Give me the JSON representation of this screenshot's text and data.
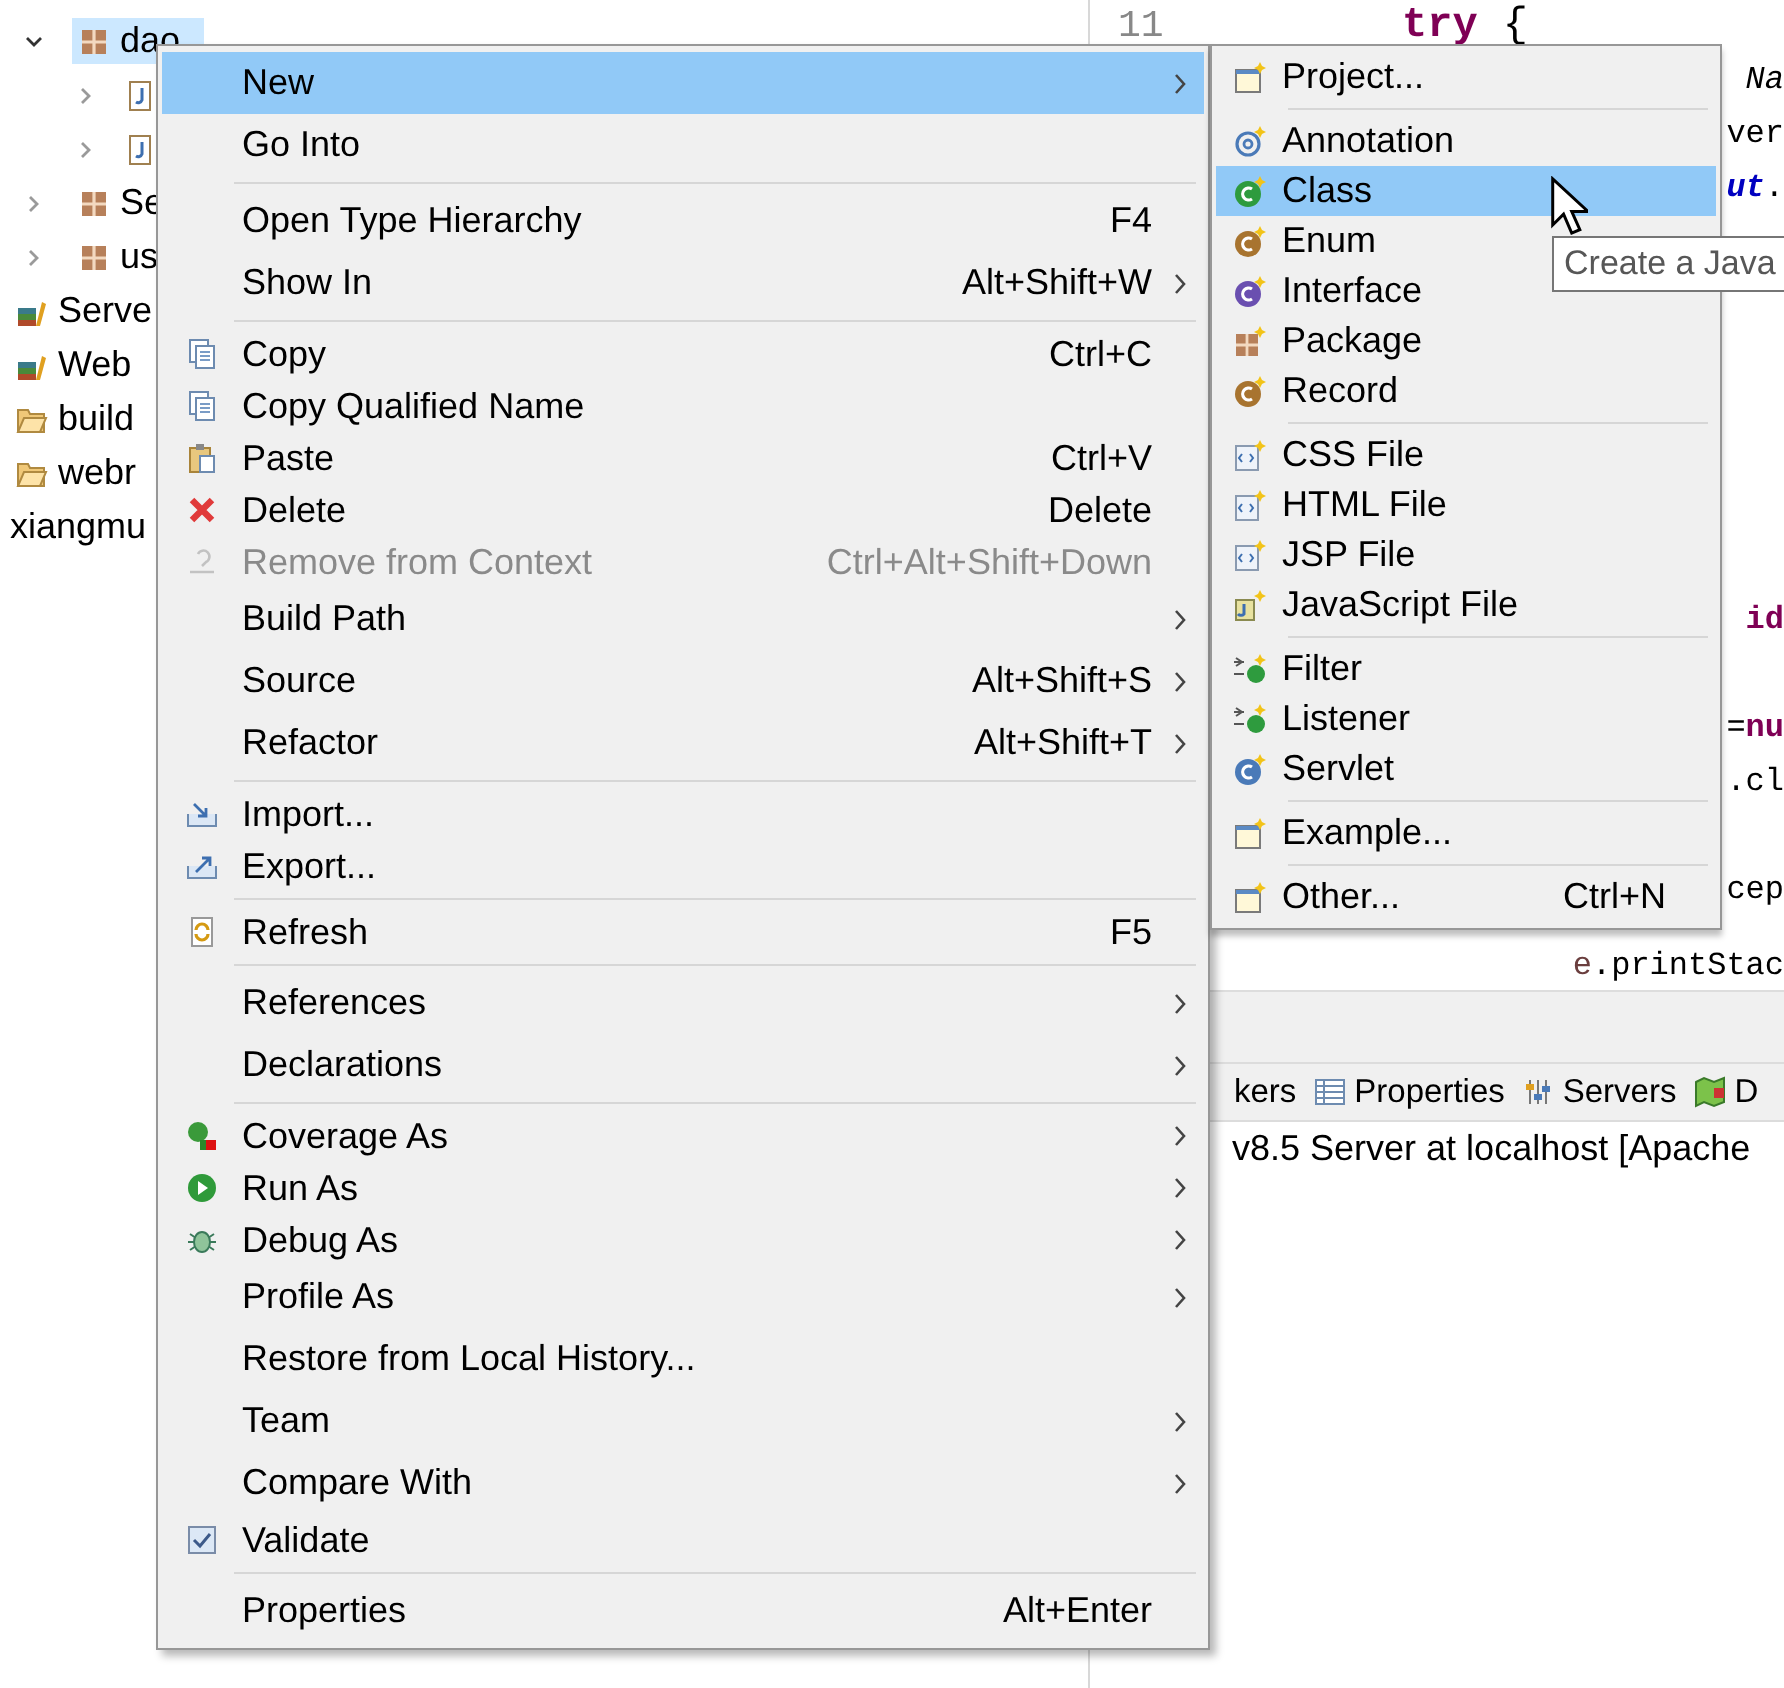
{
  "project_explorer": {
    "items": [
      {
        "kind": "package",
        "label": "dao",
        "expanded": true,
        "selected": true,
        "children": [
          {
            "kind": "java_file",
            "expanded": false
          },
          {
            "kind": "java_file",
            "expanded": false
          }
        ]
      },
      {
        "kind": "package",
        "label": "Se",
        "expanded": false,
        "selected": false
      },
      {
        "kind": "package",
        "label": "us",
        "expanded": false,
        "selected": false
      },
      {
        "kind": "library",
        "label": "Serve",
        "selected": false
      },
      {
        "kind": "library",
        "label": "Web",
        "selected": false
      },
      {
        "kind": "folder",
        "label": "build",
        "selected": false
      },
      {
        "kind": "folder",
        "label": "webr",
        "selected": false
      },
      {
        "kind": "project",
        "label": "xiangmu",
        "selected": false
      }
    ]
  },
  "editor": {
    "line_number": "11",
    "lines": [
      {
        "kind": "line",
        "segments": [
          {
            "text": "try",
            "kind": "keyword"
          },
          {
            "text": " {",
            "kind": "plain"
          }
        ]
      },
      {
        "kind": "fragment",
        "segments": [
          {
            "text": "Na",
            "kind": "italic"
          }
        ]
      },
      {
        "kind": "fragment",
        "segments": [
          {
            "text": "ver",
            "kind": "plain"
          }
        ]
      },
      {
        "kind": "fragment",
        "segments": [
          {
            "text": "ut",
            "kind": "static"
          },
          {
            "text": ".",
            "kind": "plain"
          }
        ]
      },
      {
        "kind": "fragment",
        "segments": [
          {
            "text": "id",
            "kind": "keyword"
          }
        ]
      },
      {
        "kind": "fragment",
        "segments": [
          {
            "text": "=",
            "kind": "plain"
          },
          {
            "text": "nu",
            "kind": "keyword"
          }
        ]
      },
      {
        "kind": "fragment",
        "segments": [
          {
            "text": ".cl",
            "kind": "plain"
          }
        ]
      },
      {
        "kind": "fragment",
        "segments": [
          {
            "text": "cep",
            "kind": "plain"
          }
        ]
      },
      {
        "kind": "fragment",
        "segments": [
          {
            "text": "e",
            "kind": "local"
          },
          {
            "text": ".printStac",
            "kind": "plain"
          }
        ]
      }
    ]
  },
  "bottom_panel": {
    "tabs": [
      {
        "label": "kers"
      },
      {
        "label": "Properties"
      },
      {
        "label": "Servers"
      },
      {
        "label": "D"
      }
    ],
    "console_line": "v8.5 Server at localhost [Apache"
  },
  "context_menu": {
    "items": [
      {
        "kind": "item",
        "label": "New",
        "submenu": true,
        "selected": true
      },
      {
        "kind": "item",
        "label": "Go Into",
        "selected": false
      },
      {
        "kind": "separator"
      },
      {
        "kind": "item",
        "label": "Open Type Hierarchy",
        "shortcut": "F4",
        "selected": false
      },
      {
        "kind": "item",
        "label": "Show In",
        "shortcut": "Alt+Shift+W",
        "submenu": true,
        "selected": false
      },
      {
        "kind": "separator"
      },
      {
        "kind": "item",
        "label": "Copy",
        "shortcut": "Ctrl+C",
        "selected": false
      },
      {
        "kind": "item",
        "label": "Copy Qualified Name",
        "selected": false
      },
      {
        "kind": "item",
        "label": "Paste",
        "shortcut": "Ctrl+V",
        "selected": false
      },
      {
        "kind": "item",
        "label": "Delete",
        "shortcut": "Delete",
        "selected": false
      },
      {
        "kind": "item",
        "label": "Remove from Context",
        "shortcut": "Ctrl+Alt+Shift+Down",
        "selected": false,
        "disabled": true
      },
      {
        "kind": "item",
        "label": "Build Path",
        "submenu": true,
        "selected": false
      },
      {
        "kind": "item",
        "label": "Source",
        "shortcut": "Alt+Shift+S",
        "submenu": true,
        "selected": false
      },
      {
        "kind": "item",
        "label": "Refactor",
        "shortcut": "Alt+Shift+T",
        "submenu": true,
        "selected": false
      },
      {
        "kind": "separator"
      },
      {
        "kind": "item",
        "label": "Import...",
        "selected": false
      },
      {
        "kind": "item",
        "label": "Export...",
        "selected": false
      },
      {
        "kind": "separator"
      },
      {
        "kind": "item",
        "label": "Refresh",
        "shortcut": "F5",
        "selected": false
      },
      {
        "kind": "separator"
      },
      {
        "kind": "item",
        "label": "References",
        "submenu": true,
        "selected": false
      },
      {
        "kind": "item",
        "label": "Declarations",
        "submenu": true,
        "selected": false
      },
      {
        "kind": "separator"
      },
      {
        "kind": "item",
        "label": "Coverage As",
        "submenu": true,
        "selected": false
      },
      {
        "kind": "item",
        "label": "Run As",
        "submenu": true,
        "selected": false
      },
      {
        "kind": "item",
        "label": "Debug As",
        "submenu": true,
        "selected": false
      },
      {
        "kind": "item",
        "label": "Profile As",
        "submenu": true,
        "selected": false
      },
      {
        "kind": "item",
        "label": "Restore from Local History...",
        "selected": false
      },
      {
        "kind": "item",
        "label": "Team",
        "submenu": true,
        "selected": false
      },
      {
        "kind": "item",
        "label": "Compare With",
        "submenu": true,
        "selected": false
      },
      {
        "kind": "check",
        "label": "Validate",
        "checked": true,
        "selected": false
      },
      {
        "kind": "separator"
      },
      {
        "kind": "item",
        "label": "Properties",
        "shortcut": "Alt+Enter",
        "selected": false
      }
    ]
  },
  "submenu": {
    "items": [
      {
        "kind": "item",
        "label": "Project...",
        "selected": false
      },
      {
        "kind": "separator"
      },
      {
        "kind": "item",
        "label": "Annotation",
        "selected": false
      },
      {
        "kind": "item",
        "label": "Class",
        "selected": true
      },
      {
        "kind": "item",
        "label": "Enum",
        "selected": false
      },
      {
        "kind": "item",
        "label": "Interface",
        "selected": false
      },
      {
        "kind": "item",
        "label": "Package",
        "selected": false
      },
      {
        "kind": "item",
        "label": "Record",
        "selected": false
      },
      {
        "kind": "separator"
      },
      {
        "kind": "item",
        "label": "CSS File",
        "selected": false
      },
      {
        "kind": "item",
        "label": "HTML File",
        "selected": false
      },
      {
        "kind": "item",
        "label": "JSP File",
        "selected": false
      },
      {
        "kind": "item",
        "label": "JavaScript File",
        "selected": false
      },
      {
        "kind": "separator"
      },
      {
        "kind": "item",
        "label": "Filter",
        "selected": false
      },
      {
        "kind": "item",
        "label": "Listener",
        "selected": false
      },
      {
        "kind": "item",
        "label": "Servlet",
        "selected": false
      },
      {
        "kind": "separator"
      },
      {
        "kind": "item",
        "label": "Example...",
        "selected": false
      },
      {
        "kind": "separator"
      },
      {
        "kind": "item",
        "label": "Other...",
        "shortcut": "Ctrl+N",
        "selected": false
      }
    ]
  },
  "tooltip": {
    "text": "Create a Java"
  }
}
